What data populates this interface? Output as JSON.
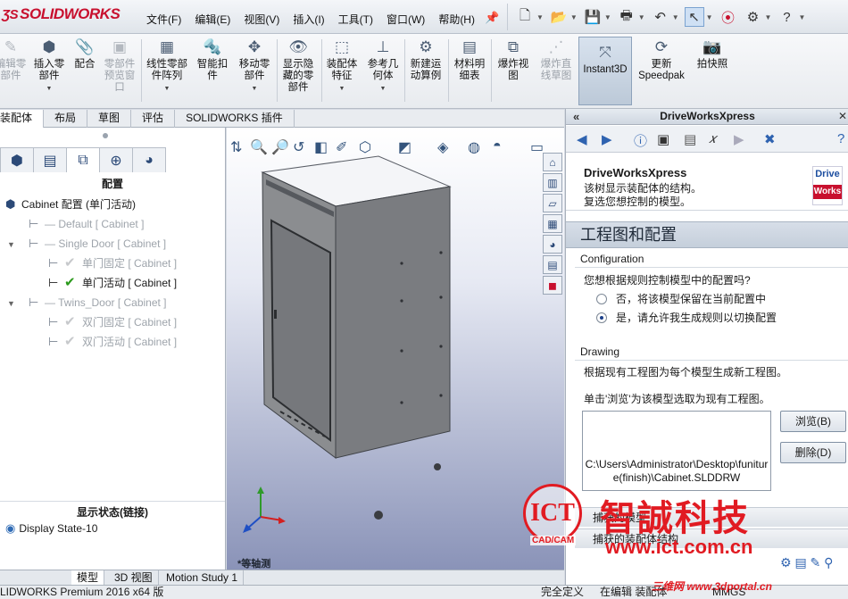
{
  "app": {
    "logo": "SOLIDWORKS",
    "menus": [
      "文件(F)",
      "编辑(E)",
      "视图(V)",
      "插入(I)",
      "工具(T)",
      "窗口(W)",
      "帮助(H)"
    ]
  },
  "ribbon": {
    "buttons": [
      {
        "label": "编辑零\n部件",
        "icon": "edit-component-icon",
        "disabled": true
      },
      {
        "label": "插入零\n部件",
        "icon": "insert-component-icon",
        "disabled": false
      },
      {
        "label": "配合",
        "icon": "mate-icon",
        "disabled": false
      },
      {
        "label": "零部件\n预览窗\n口",
        "icon": "preview-window-icon",
        "disabled": true
      },
      {
        "label": "线性零部\n件阵列",
        "icon": "linear-pattern-icon",
        "disabled": false
      },
      {
        "label": "智能扣\n件",
        "icon": "smart-fastener-icon",
        "disabled": false
      },
      {
        "label": "移动零\n部件",
        "icon": "move-component-icon",
        "disabled": false
      },
      {
        "label": "显示隐\n藏的零\n部件",
        "icon": "show-hidden-icon",
        "disabled": false
      },
      {
        "label": "装配体\n特征",
        "icon": "assembly-feature-icon",
        "disabled": false
      },
      {
        "label": "参考几\n何体",
        "icon": "reference-geometry-icon",
        "disabled": false
      },
      {
        "label": "新建运\n动算例",
        "icon": "motion-study-icon",
        "disabled": false
      },
      {
        "label": "材料明\n细表",
        "icon": "bom-icon",
        "disabled": false
      },
      {
        "label": "爆炸视\n图",
        "icon": "exploded-view-icon",
        "disabled": false
      },
      {
        "label": "爆炸直\n线草图",
        "icon": "explode-line-icon",
        "disabled": true
      },
      {
        "label": "Instant3D",
        "icon": "instant3d-icon",
        "disabled": false
      },
      {
        "label": "更新\nSpeedpak",
        "icon": "speedpak-icon",
        "disabled": false
      },
      {
        "label": "拍快照",
        "icon": "camera-icon",
        "disabled": false
      }
    ]
  },
  "command_tabs": [
    "装配体",
    "布局",
    "草图",
    "评估",
    "SOLIDWORKS 插件"
  ],
  "active_command_tab": "装配体",
  "config_manager": {
    "title": "配置",
    "root": "Cabinet 配置  (单门活动)",
    "items": [
      {
        "label": "Default [ Cabinet ]",
        "level": 1,
        "gray": true,
        "toggle": "",
        "check": ""
      },
      {
        "label": "Single Door [ Cabinet ]",
        "level": 1,
        "gray": true,
        "toggle": "▼",
        "check": ""
      },
      {
        "label": "单门固定 [ Cabinet ]",
        "level": 2,
        "gray": true,
        "toggle": "",
        "check": "gray"
      },
      {
        "label": "单门活动 [ Cabinet ]",
        "level": 2,
        "gray": false,
        "toggle": "",
        "check": "on"
      },
      {
        "label": "Twins_Door [ Cabinet ]",
        "level": 1,
        "gray": true,
        "toggle": "▼",
        "check": ""
      },
      {
        "label": "双门固定 [ Cabinet ]",
        "level": 2,
        "gray": true,
        "toggle": "",
        "check": "gray"
      },
      {
        "label": "双门活动 [ Cabinet ]",
        "level": 2,
        "gray": true,
        "toggle": "",
        "check": "gray"
      }
    ],
    "display_state_title": "显示状态(链接)",
    "display_state": "Display State-10"
  },
  "viewport": {
    "view_label": "*等轴测"
  },
  "bottom_tabs": [
    "模型",
    "3D 视图",
    "Motion Study 1"
  ],
  "status": {
    "product": "LIDWORKS Premium 2016 x64 版",
    "defined": "完全定义",
    "editing": "在编辑 装配体",
    "units": "MMGS"
  },
  "driveworks": {
    "header": "DriveWorksXpress",
    "intro_title": "DriveWorksXpress",
    "intro_line1": "该树显示装配体的结构。",
    "intro_line2": "复选您想控制的模型。",
    "logo_top": "Drive",
    "logo_bottom": "Works",
    "section_title": "工程图和配置",
    "configuration_head": "Configuration",
    "configuration_question": "您想根据规则控制模型中的配置吗?",
    "radio_no": "否，将该模型保留在当前配置中",
    "radio_yes": "是，请允许我生成规则以切换配置",
    "drawing_head": "Drawing",
    "drawing_text1": "根据现有工程图为每个模型生成新工程图。",
    "drawing_text2": "单击'浏览'为该模型选取为现有工程图。",
    "drawing_path": "C:\\Users\\Administrator\\Desktop\\funiture(finish)\\Cabinet.SLDDRW",
    "browse_btn": "浏览(B)",
    "delete_btn": "删除(D)",
    "bottom1": "捕获的模型",
    "bottom2": "捕获的装配体结构"
  },
  "watermark": {
    "logo": "ICT",
    "cadcam": "CAD/CAM",
    "cn": "智誠科技",
    "url": "www.ict.com.cn",
    "portal": "三维网 www.3dportal.cn"
  },
  "colors": {
    "brand_red": "#c8102e",
    "check_green": "#2b9a1c",
    "accent_blue": "#2f63b0"
  }
}
